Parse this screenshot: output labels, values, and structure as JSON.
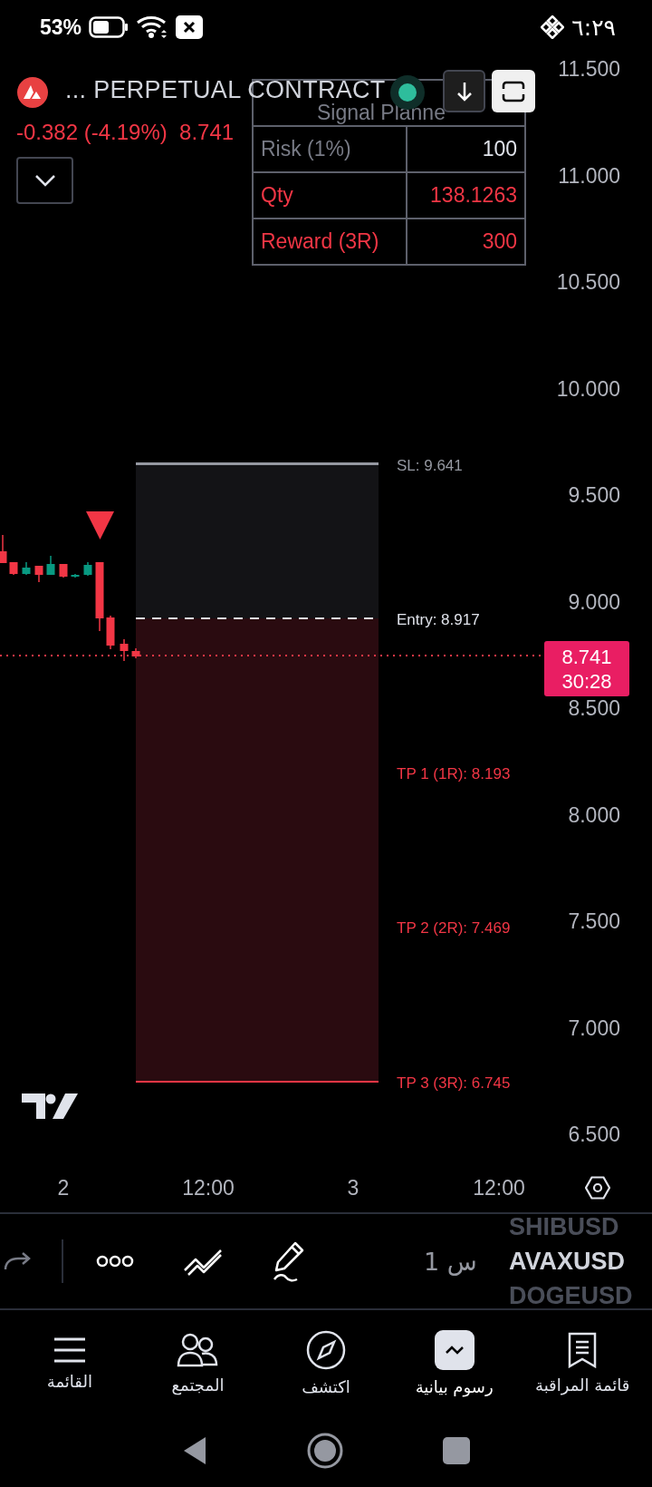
{
  "status_bar": {
    "battery": "53%",
    "time": "٦:٢٩"
  },
  "header": {
    "symbol": "... PERPETUAL CONTRACT",
    "change": "-0.382 (-4.19%)",
    "price": "8.741"
  },
  "signal_planner": {
    "title": "Signal Planne",
    "rows": [
      {
        "label": "Risk (1%)",
        "value": "100",
        "kind": "neutral"
      },
      {
        "label": "Qty",
        "value": "138.1263",
        "kind": "loss"
      },
      {
        "label": "Reward (3R)",
        "value": "300",
        "kind": "loss"
      }
    ]
  },
  "price_axis": [
    "11.500",
    "11.000",
    "10.500",
    "10.000",
    "9.500",
    "9.000",
    "8.500",
    "8.000",
    "7.500",
    "7.000",
    "6.500"
  ],
  "position_levels": [
    {
      "kind": "stop",
      "label": "SL: 9.641"
    },
    {
      "kind": "entry",
      "label": "Entry: 8.917"
    },
    {
      "kind": "target",
      "label": "TP 1 (1R): 8.193"
    },
    {
      "kind": "target",
      "label": "TP 2 (2R): 7.469"
    },
    {
      "kind": "target",
      "label": "TP 3 (3R): 6.745"
    }
  ],
  "last_price": {
    "price": "8.741",
    "countdown": "30:28"
  },
  "time_axis": [
    "2",
    "12:00",
    "3",
    "12:00"
  ],
  "toolbar": {
    "interval": "1 س",
    "symbols": [
      {
        "label": "SHIBUSD",
        "selected": false
      },
      {
        "label": "AVAXUSD",
        "selected": true
      },
      {
        "label": "DOGEUSD",
        "selected": false
      }
    ]
  },
  "nav": [
    {
      "label": "قائمة المراقبة",
      "selected": false,
      "kind": "watchlist"
    },
    {
      "label": "رسوم بيانية",
      "selected": true,
      "kind": "chart"
    },
    {
      "label": "اكتشف",
      "selected": false,
      "kind": "explore"
    },
    {
      "label": "المجتمع",
      "selected": false,
      "kind": "community"
    },
    {
      "label": "القائمة",
      "selected": false,
      "kind": "menu"
    }
  ]
}
